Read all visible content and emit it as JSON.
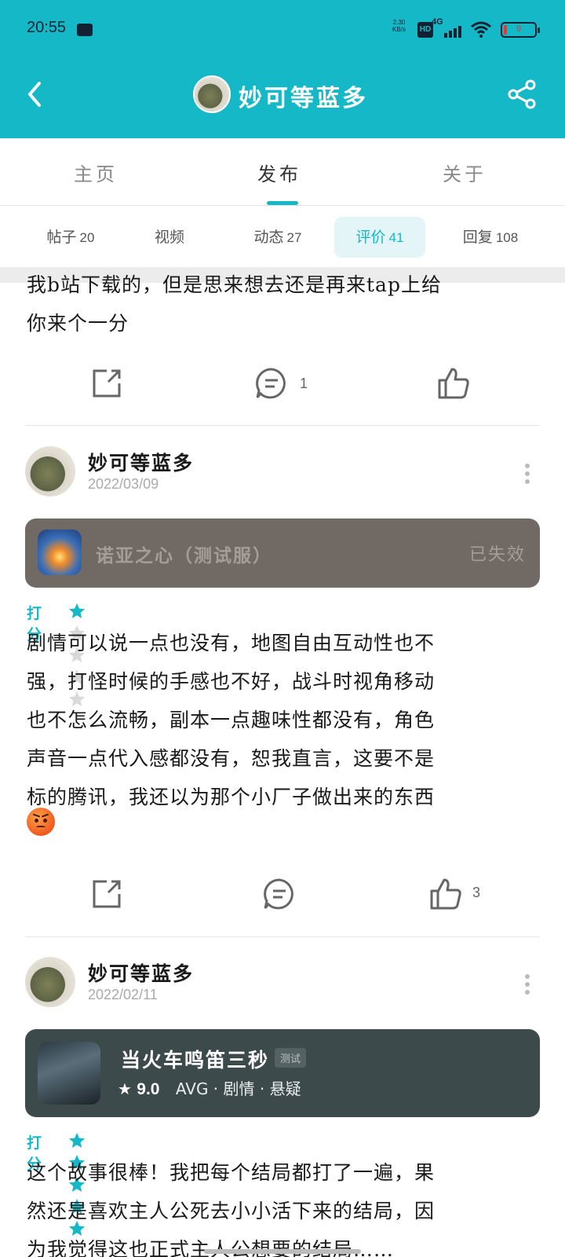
{
  "status_bar": {
    "time": "20:55",
    "speed_top": "2.30",
    "speed_bottom": "KB/s",
    "hd": "HD",
    "network": "4G",
    "battery": "9"
  },
  "nav": {
    "title": "妙可等蓝多",
    "icons": [
      "back-arrow-icon",
      "share-icon"
    ]
  },
  "tabs": [
    {
      "label": "主页"
    },
    {
      "label": "发布"
    },
    {
      "label": "关于"
    }
  ],
  "subtabs": [
    {
      "label": "帖子",
      "count": "20"
    },
    {
      "label": "视频",
      "count": ""
    },
    {
      "label": "动态",
      "count": "27"
    },
    {
      "label": "评价",
      "count": "41"
    },
    {
      "label": "回复",
      "count": "108"
    }
  ],
  "colors": {
    "accent": "#14b8c7",
    "star_on": "#14b8c7",
    "star_off": "#d9d9d9"
  },
  "posts": [
    {
      "text_lines": [
        "我b站下载的，但是思来想去还是再来tap上给",
        "你来个一分"
      ],
      "comment_count": "1",
      "like_count": ""
    },
    {
      "user": "妙可等蓝多",
      "date": "2022/03/09",
      "game": {
        "name": "诺亚之心（测试服）",
        "status": "已失效"
      },
      "score_label": "打分",
      "stars": 1,
      "text_lines": [
        "剧情可以说一点也没有，地图自由互动性也不",
        "强，打怪时候的手感也不好，战斗时视角移动",
        "也不怎么流畅，副本一点趣味性都没有，角色",
        "声音一点代入感都没有，恕我直言，这要不是",
        "标的腾讯，我还以为那个小厂子做出来的东西"
      ],
      "emoji": "angry-face-emoji",
      "comment_count": "",
      "like_count": "3"
    },
    {
      "user": "妙可等蓝多",
      "date": "2022/02/11",
      "game": {
        "name": "当火车鸣笛三秒",
        "tag": "测试",
        "rating": "9.0",
        "genre": "AVG · 剧情 · 悬疑"
      },
      "score_label": "打分",
      "stars": 5,
      "text_lines": [
        "这个故事很棒！我把每个结局都打了一遍，果",
        "然还是喜欢主人公死去小小活下来的结局，因",
        "为我觉得这也正式主人公想要的结局……"
      ]
    }
  ]
}
